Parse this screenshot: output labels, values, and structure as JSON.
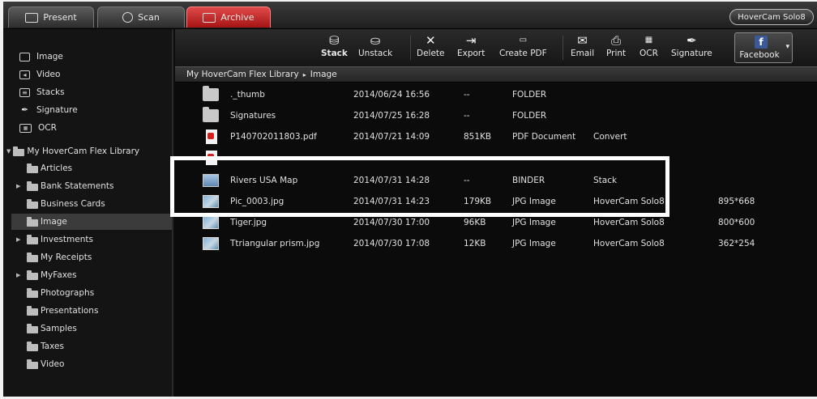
{
  "tabs": [
    {
      "label": "Present",
      "icon": "monitor-icon"
    },
    {
      "label": "Scan",
      "icon": "camera-icon"
    },
    {
      "label": "Archive",
      "icon": "archive-icon"
    }
  ],
  "device": "HoverCam Solo8",
  "toolbar": {
    "stack": "Stack",
    "unstack": "Unstack",
    "delete": "Delete",
    "export": "Export",
    "create_pdf": "Create PDF",
    "email": "Email",
    "print": "Print",
    "ocr": "OCR",
    "signature": "Signature",
    "facebook": "Facebook"
  },
  "breadcrumb": {
    "library": "My HoverCam Flex Library",
    "current": "Image"
  },
  "sidebar": {
    "top_items": [
      {
        "label": "Image",
        "icon": "image-icon"
      },
      {
        "label": "Video",
        "icon": "video-icon"
      },
      {
        "label": "Stacks",
        "icon": "stacks-icon"
      },
      {
        "label": "Signature",
        "icon": "pen-icon"
      },
      {
        "label": "OCR",
        "icon": "ocr-icon"
      }
    ],
    "library": "My HoverCam Flex Library",
    "folders": [
      {
        "label": "Articles",
        "expandable": false
      },
      {
        "label": "Bank Statements",
        "expandable": true
      },
      {
        "label": "Business Cards",
        "expandable": false
      },
      {
        "label": "Image",
        "expandable": false,
        "selected": true
      },
      {
        "label": "Investments",
        "expandable": true
      },
      {
        "label": "My Receipts",
        "expandable": false
      },
      {
        "label": "MyFaxes",
        "expandable": true
      },
      {
        "label": "Photographs",
        "expandable": false
      },
      {
        "label": "Presentations",
        "expandable": false
      },
      {
        "label": "Samples",
        "expandable": false
      },
      {
        "label": "Taxes",
        "expandable": false
      },
      {
        "label": "Video",
        "expandable": false
      }
    ]
  },
  "files": [
    {
      "name": "._thumb",
      "date": "2014/06/24 16:56",
      "size": "--",
      "type": "FOLDER",
      "info": "",
      "dims": "",
      "icon": "folder"
    },
    {
      "name": "Signatures",
      "date": "2014/07/25 16:28",
      "size": "--",
      "type": "FOLDER",
      "info": "",
      "dims": "",
      "icon": "folder"
    },
    {
      "name": "P140702011803.pdf",
      "date": "2014/07/21 14:09",
      "size": "851KB",
      "type": "PDF Document",
      "info": "Convert",
      "dims": "",
      "icon": "pdf"
    },
    {
      "name": "Rivers USA Map",
      "date": "2014/07/31 14:28",
      "size": "--",
      "type": "BINDER",
      "info": "Stack",
      "dims": "",
      "icon": "binder"
    },
    {
      "name": "Pic_0003.jpg",
      "date": "2014/07/31 14:23",
      "size": "179KB",
      "type": "JPG Image",
      "info": "HoverCam Solo8",
      "dims": "895*668",
      "icon": "image"
    },
    {
      "name": "Tiger.jpg",
      "date": "2014/07/30 17:00",
      "size": "96KB",
      "type": "JPG Image",
      "info": "HoverCam Solo8",
      "dims": "800*600",
      "icon": "image"
    },
    {
      "name": "Ttriangular prism.jpg",
      "date": "2014/07/30 17:08",
      "size": "12KB",
      "type": "JPG Image",
      "info": "HoverCam Solo8",
      "dims": "362*254",
      "icon": "image"
    }
  ]
}
